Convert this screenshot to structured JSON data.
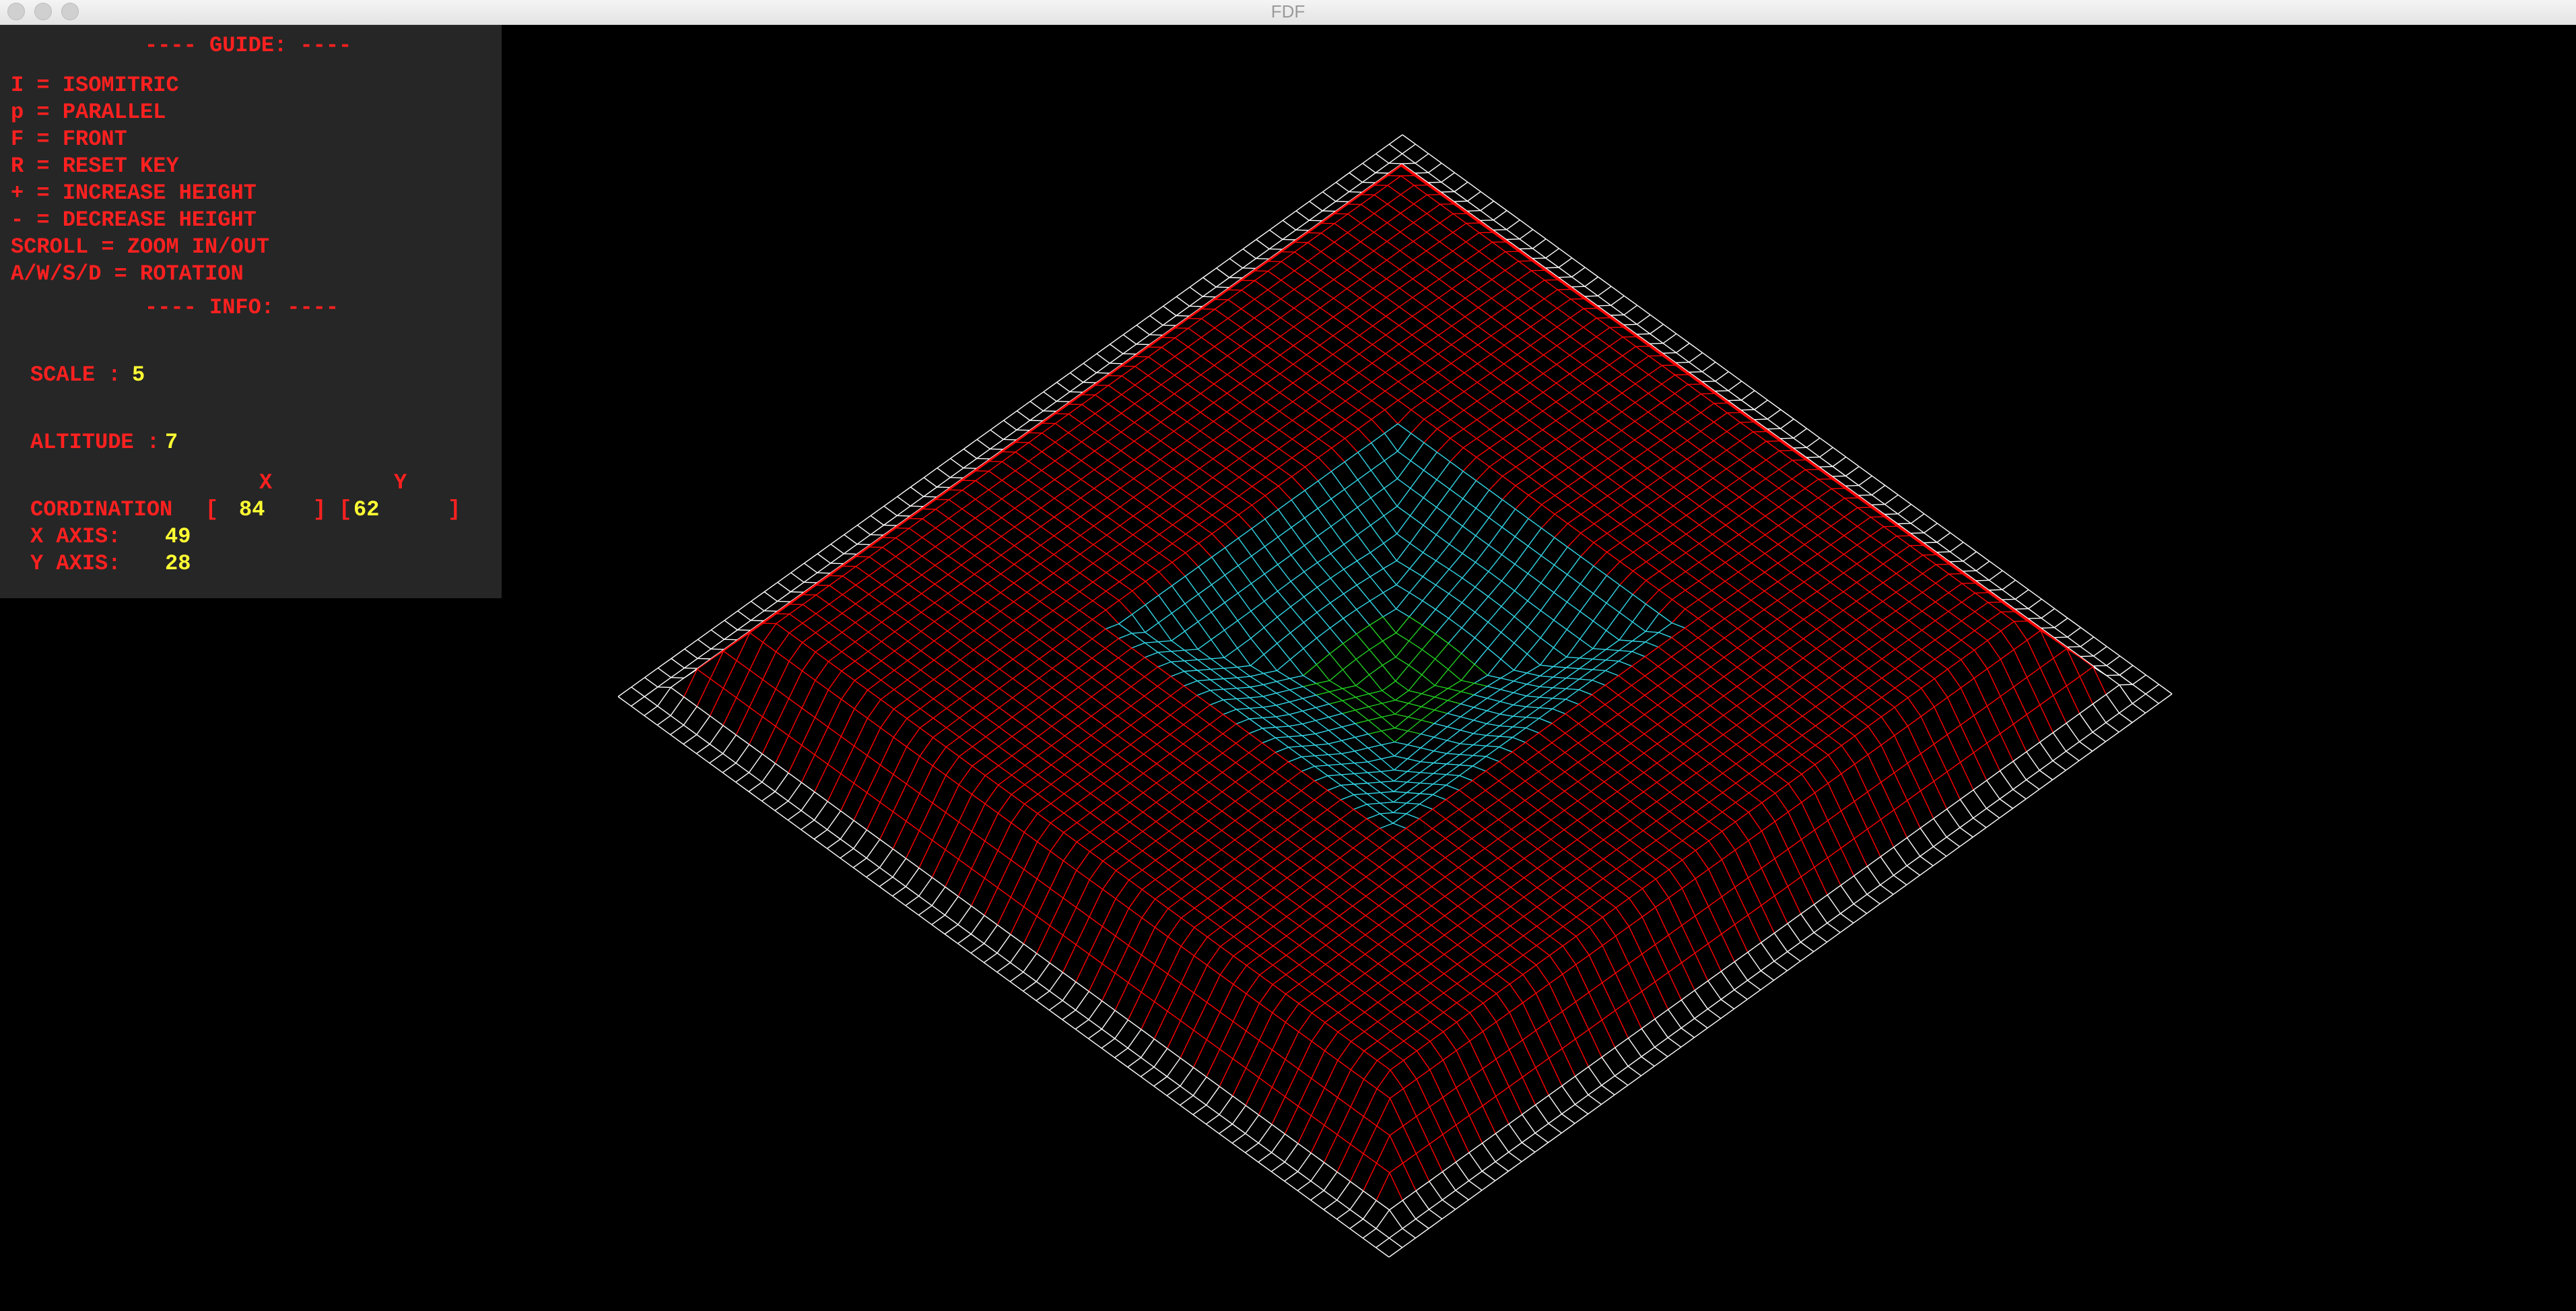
{
  "window": {
    "title": "FDF"
  },
  "guide": {
    "header": "---- GUIDE: ----",
    "items": [
      "I = ISOMITRIC",
      "p = PARALLEL",
      "F = FRONT",
      "R = RESET KEY",
      "+ = INCREASE HEIGHT",
      "- = DECREASE HEIGHT",
      "SCROLL = ZOOM IN/OUT",
      "A/W/S/D = ROTATION"
    ]
  },
  "info": {
    "header": "---- INFO: ----",
    "scale_label": "SCALE :",
    "scale_value": "5",
    "altitude_label": "ALTITUDE :",
    "altitude_value": "7",
    "x_header": "X",
    "y_header": "Y",
    "cordination_label": "CORDINATION",
    "open_x": "[",
    "cord_x": "84",
    "mid": "] [",
    "cord_y": "62",
    "close_y": "]",
    "x_axis_label": "X AXIS:",
    "x_axis_value": "49",
    "y_axis_label": "Y AXIS:",
    "y_axis_value": "28"
  },
  "colors": {
    "panel_text": "#ff2020",
    "panel_value": "#ffff33",
    "panel_bg": "#262626",
    "mesh_flat": "#ffffff",
    "mesh_wall": "#ff0000",
    "mesh_pit": "#33d6e6",
    "mesh_bottom": "#22cc22"
  }
}
